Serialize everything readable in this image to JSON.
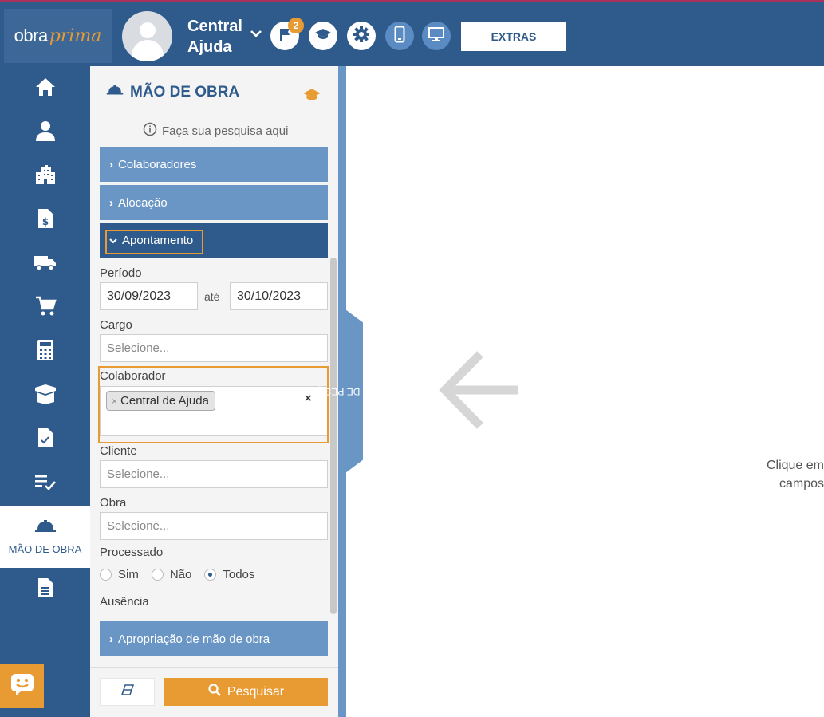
{
  "header": {
    "logo_main": "obra",
    "logo_accent": "prima",
    "user_name": "Central Ajuda",
    "notification_count": "2",
    "extras_label": "EXTRAS",
    "icons": [
      "flag-icon",
      "graduation-cap-icon",
      "gear-icon",
      "mobile-icon",
      "desktop-icon"
    ]
  },
  "sidebar": {
    "items": [
      {
        "icon": "home-icon"
      },
      {
        "icon": "user-icon"
      },
      {
        "icon": "building-icon"
      },
      {
        "icon": "invoice-icon"
      },
      {
        "icon": "truck-icon"
      },
      {
        "icon": "cart-icon"
      },
      {
        "icon": "calculator-icon"
      },
      {
        "icon": "box-icon"
      },
      {
        "icon": "document-check-icon"
      },
      {
        "icon": "checklist-icon"
      },
      {
        "icon": "hardhat-icon",
        "label": "MÃO DE OBRA",
        "active": true
      },
      {
        "icon": "document-icon"
      }
    ]
  },
  "panel": {
    "title": "MÃO DE OBRA",
    "hint": "Faça sua pesquisa aqui",
    "sections": {
      "colaboradores": "Colaboradores",
      "alocacao": "Alocação",
      "apontamento": "Apontamento",
      "apropriacao": "Apropriação de mão de obra"
    },
    "periodo": {
      "label": "Período",
      "start": "30/09/2023",
      "separator": "até",
      "end": "30/10/2023"
    },
    "cargo": {
      "label": "Cargo",
      "placeholder": "Selecione..."
    },
    "colaborador": {
      "label": "Colaborador",
      "tags": [
        "Central de Ajuda"
      ],
      "clear": "×"
    },
    "cliente": {
      "label": "Cliente",
      "placeholder": "Selecione..."
    },
    "obra": {
      "label": "Obra",
      "placeholder": "Selecione..."
    },
    "processado": {
      "label": "Processado",
      "options": [
        "Sim",
        "Não",
        "Todos"
      ],
      "selected": "Todos"
    },
    "ausencia": {
      "label": "Ausência"
    },
    "search_label": "Pesquisar"
  },
  "filter_tab": {
    "label": "FILTROS DE PESQUISA"
  },
  "main": {
    "message_line1": "Clique em",
    "message_line2": "campos"
  },
  "colors": {
    "primary": "#2f5b8c",
    "light_blue": "#6a96c6",
    "accent": "#e99b33"
  }
}
